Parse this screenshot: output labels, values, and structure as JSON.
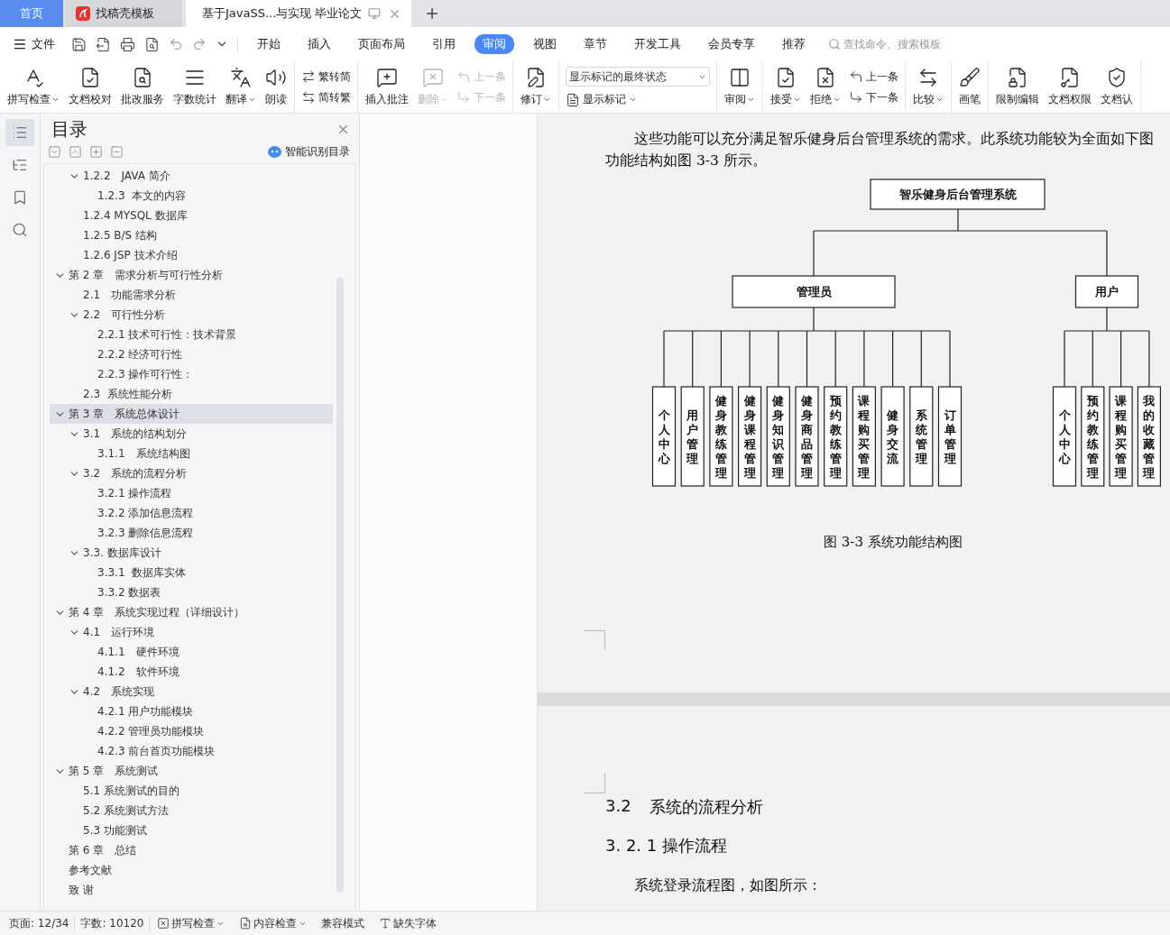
{
  "tabs": [
    {
      "label": "首页",
      "kind": "home",
      "selected": false
    },
    {
      "label": "找稿壳模板",
      "kind": "app",
      "selected": false
    },
    {
      "label": "基于JavaSS...与实现 毕业论文",
      "kind": "doc",
      "selected": true
    }
  ],
  "menu": {
    "file": "文件",
    "tabs": [
      {
        "label": "开始",
        "selected": false
      },
      {
        "label": "插入",
        "selected": false
      },
      {
        "label": "页面布局",
        "selected": false
      },
      {
        "label": "引用",
        "selected": false
      },
      {
        "label": "审阅",
        "selected": true
      },
      {
        "label": "视图",
        "selected": false
      },
      {
        "label": "章节",
        "selected": false
      },
      {
        "label": "开发工具",
        "selected": false
      },
      {
        "label": "会员专享",
        "selected": false
      },
      {
        "label": "推荐",
        "selected": false
      }
    ],
    "search": {
      "placeholder": "查找命令、搜索模板"
    }
  },
  "ribbon": {
    "groups": [
      [
        {
          "kind": "large",
          "label": "拼写检查",
          "dropdown": true,
          "disabled": false
        },
        {
          "kind": "large",
          "label": "文档校对",
          "dropdown": false,
          "disabled": false
        },
        {
          "kind": "large",
          "label": "批改服务",
          "dropdown": false,
          "disabled": false
        },
        {
          "kind": "large",
          "label": "字数统计",
          "dropdown": false,
          "disabled": false
        },
        {
          "kind": "large",
          "label": "翻译",
          "dropdown": true,
          "disabled": false
        },
        {
          "kind": "large",
          "label": "朗读",
          "dropdown": false,
          "disabled": false
        }
      ],
      [
        {
          "kind": "pair",
          "items": [
            {
              "label": "繁转简",
              "disabled": false
            },
            {
              "label": "简转繁",
              "disabled": false
            }
          ]
        }
      ],
      [
        {
          "kind": "large",
          "label": "插入批注",
          "dropdown": false,
          "disabled": false
        },
        {
          "kind": "large",
          "label": "删除",
          "dropdown": true,
          "disabled": true
        },
        {
          "kind": "pair",
          "items": [
            {
              "label": "上一条",
              "disabled": true
            },
            {
              "label": "下一条",
              "disabled": true
            }
          ]
        }
      ],
      [
        {
          "kind": "large",
          "label": "修订",
          "dropdown": true,
          "disabled": false
        }
      ],
      [
        {
          "kind": "select",
          "value": "显示标记的最终状态",
          "below": {
            "label": "显示标记",
            "dropdown": true
          }
        }
      ],
      [
        {
          "kind": "large",
          "label": "审阅",
          "dropdown": true,
          "disabled": false
        }
      ],
      [
        {
          "kind": "large",
          "label": "接受",
          "dropdown": true,
          "disabled": false
        },
        {
          "kind": "large",
          "label": "拒绝",
          "dropdown": true,
          "disabled": false
        },
        {
          "kind": "pair",
          "items": [
            {
              "label": "上一条",
              "disabled": false
            },
            {
              "label": "下一条",
              "disabled": false
            }
          ]
        }
      ],
      [
        {
          "kind": "large",
          "label": "比较",
          "dropdown": true,
          "disabled": false
        }
      ],
      [
        {
          "kind": "large",
          "label": "画笔",
          "dropdown": false,
          "disabled": false
        }
      ],
      [
        {
          "kind": "large",
          "label": "限制编辑",
          "dropdown": false,
          "disabled": false
        },
        {
          "kind": "large",
          "label": "文档权限",
          "dropdown": false,
          "disabled": false
        },
        {
          "kind": "large",
          "label": "文档认",
          "dropdown": false,
          "disabled": false
        }
      ]
    ]
  },
  "sidebar": {
    "tools": [
      {
        "selected": true
      },
      {
        "selected": false
      },
      {
        "selected": false
      },
      {
        "selected": false
      }
    ],
    "title": "目录",
    "smart_link": "智能识别目录",
    "toc": {
      "continued": [
        {
          "label": "1.2.2　JAVA 简介",
          "selected": false,
          "expanded": true,
          "children": [
            {
              "label": "1.2.3  本文的内容",
              "selected": false
            }
          ]
        },
        {
          "label": "1.2.4 MYSQL 数据库",
          "selected": false
        },
        {
          "label": "1.2.5 B/S 结构",
          "selected": false
        },
        {
          "label": "1.2.6 JSP 技术介绍",
          "selected": false
        }
      ],
      "items": [
        {
          "label": "第 2 章　需求分析与可行性分析",
          "selected": false,
          "expanded": true,
          "children": [
            {
              "label": "2.1　功能需求分析",
              "selected": false
            },
            {
              "label": "2.2　可行性分析",
              "selected": false,
              "expanded": true,
              "children": [
                {
                  "label": "2.2.1 技术可行性：技术背景",
                  "selected": false
                },
                {
                  "label": "2.2.2 经济可行性",
                  "selected": false
                },
                {
                  "label": "2.2.3 操作可行性：",
                  "selected": false
                }
              ]
            },
            {
              "label": "2.3  系统性能分析",
              "selected": false
            }
          ]
        },
        {
          "label": "第 3 章　系统总体设计",
          "selected": true,
          "expanded": true,
          "children": [
            {
              "label": "3.1　系统的结构划分",
              "selected": false,
              "expanded": true,
              "children": [
                {
                  "label": "3.1.1　系统结构图",
                  "selected": false
                }
              ]
            },
            {
              "label": "3.2　系统的流程分析",
              "selected": false,
              "expanded": true,
              "children": [
                {
                  "label": "3.2.1 操作流程",
                  "selected": false
                },
                {
                  "label": "3.2.2 添加信息流程",
                  "selected": false
                },
                {
                  "label": "3.2.3 删除信息流程",
                  "selected": false
                }
              ]
            },
            {
              "label": "3.3. 数据库设计",
              "selected": false,
              "expanded": true,
              "children": [
                {
                  "label": "3.3.1  数据库实体",
                  "selected": false
                },
                {
                  "label": "3.3.2 数据表",
                  "selected": false
                }
              ]
            }
          ]
        },
        {
          "label": "第 4 章　系统实现过程（详细设计）",
          "selected": false,
          "expanded": true,
          "children": [
            {
              "label": "4.1　运行环境",
              "selected": false,
              "expanded": true,
              "children": [
                {
                  "label": "4.1.1　硬件环境",
                  "selected": false
                },
                {
                  "label": "4.1.2　软件环境",
                  "selected": false
                }
              ]
            },
            {
              "label": "4.2　系统实现",
              "selected": false,
              "expanded": true,
              "children": [
                {
                  "label": "4.2.1 用户功能模块",
                  "selected": false
                },
                {
                  "label": "4.2.2 管理员功能模块",
                  "selected": false
                },
                {
                  "label": "4.2.3 前台首页功能模块",
                  "selected": false
                }
              ]
            }
          ]
        },
        {
          "label": "第 5 章　系统测试",
          "selected": false,
          "expanded": true,
          "children": [
            {
              "label": "5.1 系统测试的目的",
              "selected": false
            },
            {
              "label": "5.2 系统测试方法",
              "selected": false
            },
            {
              "label": "5.3 功能测试",
              "selected": false
            }
          ]
        },
        {
          "label": "第 6 章　总结",
          "selected": false
        },
        {
          "label": "参考文献",
          "selected": false
        },
        {
          "label": "致 谢",
          "selected": false
        }
      ]
    }
  },
  "document": {
    "page_1": {
      "paragraph_lines": [
        "这些功能可以充分满足智乐健身后台管理系统的需求。此系统功能较为全面如下图",
        "功能结构如图 3-3 所示。"
      ],
      "org_chart": {
        "root": "智乐健身后台管理系统",
        "branches": [
          {
            "label": "管理员",
            "children": [
              "个人中心",
              "用户管理",
              "健身教练管理",
              "健身课程管理",
              "健身知识管理",
              "健身商品管理",
              "预约教练管理",
              "课程购买管理",
              "健身交流",
              "系统管理",
              "订单管理"
            ]
          },
          {
            "label": "用户",
            "children": [
              "个人中心",
              "预约教练管理",
              "课程购买管理",
              "我的收藏管理"
            ]
          }
        ]
      },
      "caption": "图 3-3 系统功能结构图"
    },
    "page_2": {
      "heading_number": "3.2",
      "heading_title": "系统的流程分析",
      "subheading": "3. 2. 1 操作流程",
      "paragraph": "系统登录流程图，如图所示："
    }
  },
  "status_bar": {
    "page": "页面: 12/34",
    "words": "字数: 10120",
    "items": [
      {
        "label": "拼写检查",
        "dropdown": true
      },
      {
        "label": "内容检查",
        "dropdown": true
      },
      {
        "label": "兼容模式",
        "dropdown": false
      },
      {
        "label": "缺失字体",
        "dropdown": false
      }
    ]
  }
}
